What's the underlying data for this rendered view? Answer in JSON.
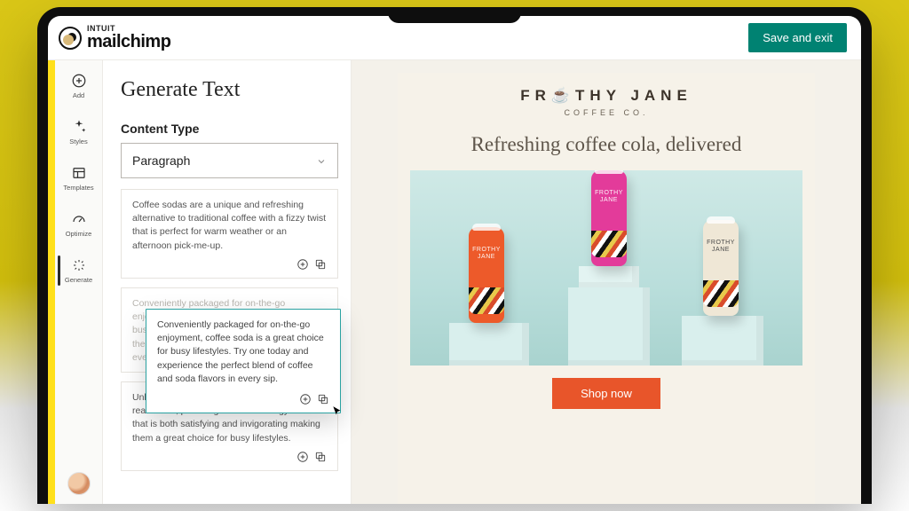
{
  "colors": {
    "accent": "#008272",
    "rail": "#ffe01b",
    "cta": "#e8552a",
    "popover_border": "#2aa2a2"
  },
  "header": {
    "brand_top": "INTUIT",
    "brand_main": "mailchimp",
    "save_label": "Save and exit"
  },
  "sidebar": {
    "items": [
      {
        "id": "add",
        "label": "Add"
      },
      {
        "id": "styles",
        "label": "Styles"
      },
      {
        "id": "templates",
        "label": "Templates"
      },
      {
        "id": "optimize",
        "label": "Optimize"
      },
      {
        "id": "generate",
        "label": "Generate"
      }
    ],
    "active": "generate"
  },
  "panel": {
    "title": "Generate Text",
    "content_type_label": "Content Type",
    "content_type_value": "Paragraph",
    "suggestions": [
      "Coffee sodas are a unique and refreshing alternative to traditional coffee with a fizzy twist that is perfect for warm weather or an afternoon pick-me-up.",
      "Conveniently packaged for on-the-go enjoyment, coffee soda is a great choice for busy lifestyles. Try one today and experience the perfect blend of coffee and soda flavors in every sip.",
      "Unlike many other coffee sodas, ours contain real coffee, providing a natural energy boost that is both satisfying and invigorating making them a great choice for busy lifestyles."
    ],
    "popover_text": "Conveniently packaged for on-the-go enjoyment, coffee soda is a great choice for busy lifestyles. Try one today and experience the perfect blend of coffee and soda flavors in every sip."
  },
  "canvas": {
    "brand_line1a": "FR",
    "brand_line1b": "THY JANE",
    "brand_line2": "COFFEE CO.",
    "headline": "Refreshing coffee cola, delivered",
    "can_label": "FROTHY JANE",
    "cta": "Shop now"
  }
}
